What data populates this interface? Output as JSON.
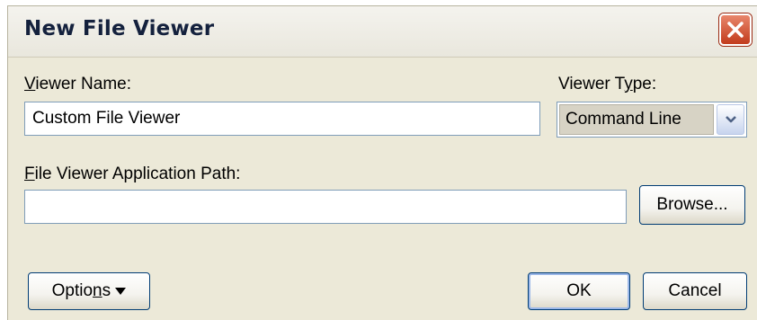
{
  "dialog": {
    "title": "New File Viewer"
  },
  "viewer_name": {
    "label_access_key": "V",
    "label_rest": "iewer Name:",
    "value": "Custom File Viewer"
  },
  "viewer_type": {
    "label_pre": "Viewer T",
    "label_access_key": "y",
    "label_post": "pe:",
    "selected": "Command Line"
  },
  "app_path": {
    "label_access_key": "F",
    "label_rest": "ile Viewer Application Path:",
    "value": "",
    "browse_label": "Browse..."
  },
  "footer": {
    "options_pre": "Optio",
    "options_access_key": "n",
    "options_post": "s",
    "ok_label": "OK",
    "cancel_label": "Cancel"
  },
  "icons": {
    "close": "close-icon",
    "dropdown": "chevron-down-icon",
    "options_menu": "triangle-down-icon"
  },
  "colors": {
    "close_button": "#c23b1c",
    "window_face": "#ece9d8",
    "field_border": "#7f9db9",
    "title_text": "#14213d"
  }
}
